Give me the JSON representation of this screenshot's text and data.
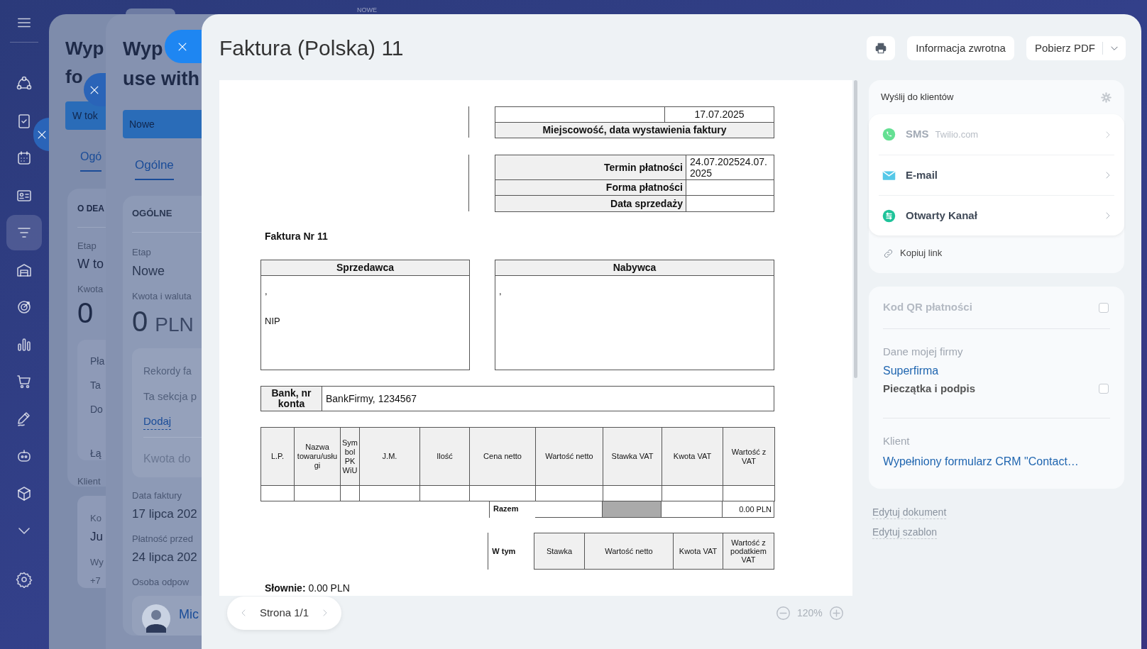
{
  "top_label": "NOWE",
  "sidebar": {
    "items": [
      {
        "selected": false
      },
      {
        "selected": false
      },
      {
        "selected": false
      },
      {
        "selected": false
      },
      {
        "selected": true
      },
      {
        "selected": false
      },
      {
        "selected": false
      },
      {
        "selected": false
      },
      {
        "selected": false
      },
      {
        "selected": false
      },
      {
        "selected": false
      },
      {
        "selected": false
      },
      {
        "selected": false
      }
    ]
  },
  "panel_1": {
    "title": [
      "Wyp",
      "fo"
    ],
    "stage_button": "W tok",
    "tab": "Ogó",
    "section_title": "O DEA",
    "stage_label": "Etap",
    "stage_value": "W to",
    "amount_label": "Kwota",
    "amount_value": "0",
    "card_lines": [
      "Pła",
      "Ta",
      "Do",
      "Łą"
    ],
    "client_label": "Klient",
    "client_lines": [
      "Ko",
      "Ju",
      "Wy",
      "+7"
    ]
  },
  "panel_2": {
    "title": [
      "Wyp",
      "use with"
    ],
    "stage_button": "Nowe",
    "tab": "Ogólne",
    "section_title": "OGÓLNE",
    "stage_label": "Etap",
    "stage_value": "Nowe",
    "amount_label": "Kwota i waluta",
    "amount_value": "0",
    "currency": "PLN",
    "card": {
      "label": "Rekordy fa",
      "text": "Ta sekcja p",
      "link": "Dodaj",
      "placeholder": "Kwota do"
    },
    "fields": [
      {
        "label": "Data faktury",
        "value": "17 lipca 202"
      },
      {
        "label": "Płatność przed",
        "value": "24 lipca 202"
      }
    ],
    "person_label": "Osoba odpow",
    "person_name": "Mic"
  },
  "window": {
    "title": "Faktura (Polska) 11",
    "buttons": [
      "Informacja zwrotna",
      "Pobierz PDF"
    ]
  },
  "document": {
    "place_date": {
      "value": "17.07.2025",
      "label": "Miejscowość, data wystawienia faktury"
    },
    "payment": [
      {
        "label": "Termin płatności",
        "value": "24.07.202524.07.2025"
      },
      {
        "label": "Forma płatności"
      },
      {
        "label": "Data sprzedaży"
      }
    ],
    "invoice_number": "Faktura Nr 11",
    "seller": {
      "heading": "Sprzedawca",
      "lines": [
        ",",
        "NIP"
      ]
    },
    "buyer": {
      "heading": "Nabywca",
      "lines": [
        ","
      ]
    },
    "bank": {
      "label": "Bank, nr konta",
      "value": "BankFirmy, 1234567"
    },
    "items_table": {
      "columns": [
        "L.P.",
        "Nazwa towaru/usługi",
        "Symbol PKWiU",
        "J.M.",
        "Ilość",
        "Cena netto",
        "Wartość netto",
        "Stawka VAT",
        "Kwota VAT",
        "Wartość z VAT"
      ]
    },
    "total": {
      "label": "Razem",
      "value": "0.00 PLN"
    },
    "vat_breakdown": {
      "label": "W tym",
      "columns": [
        "Stawka",
        "Wartość netto",
        "Kwota VAT",
        "Wartość z podatkiem VAT"
      ]
    },
    "in_words": "**Słownie:** 0.00 PLN"
  },
  "pager": {
    "label": "Strona 1/1"
  },
  "zoom": {
    "value": "120%"
  },
  "send": {
    "title": "Wyślij do klientów",
    "channels": [
      {
        "kind": "sms",
        "label": "SMS",
        "provider": "Twilio.com",
        "disabled": true
      },
      {
        "kind": "email",
        "label": "E-mail",
        "disabled": false
      },
      {
        "kind": "openline",
        "label": "Otwarty Kanał",
        "disabled": false
      }
    ],
    "copy_link": "Kopiuj link"
  },
  "options": {
    "qr": {
      "label": "Kod QR płatności",
      "disabled": true,
      "checked": false
    },
    "company": {
      "label": "Dane mojej firmy",
      "value": "Superfirma"
    },
    "stamp": {
      "label": "Pieczątka i podpis",
      "checked": false
    },
    "client": {
      "label": "Klient",
      "value": "Wypełniony formularz CRM \"Contact…"
    }
  },
  "links": [
    "Edytuj dokument",
    "Edytuj szablon"
  ]
}
